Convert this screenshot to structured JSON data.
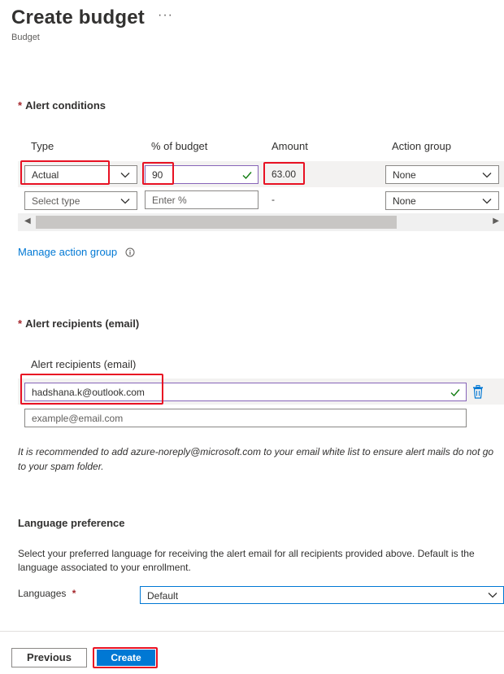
{
  "header": {
    "title": "Create budget",
    "more": "···",
    "subtitle": "Budget"
  },
  "alert_conditions": {
    "title": "Alert conditions",
    "required_mark": "*",
    "columns": [
      "Type",
      "% of budget",
      "Amount",
      "Action group"
    ],
    "rows": [
      {
        "type": "Actual",
        "percent": "90",
        "amount": "63.00",
        "action_group": "None"
      },
      {
        "type_placeholder": "Select type",
        "percent_placeholder": "Enter %",
        "amount": "-",
        "action_group": "None"
      }
    ],
    "manage_link": "Manage action group"
  },
  "alert_recipients": {
    "title": "Alert recipients (email)",
    "required_mark": "*",
    "column": "Alert recipients (email)",
    "email_value": "hadshana.k@outlook.com",
    "email_placeholder": "example@email.com",
    "note": "It is recommended to add azure-noreply@microsoft.com to your email white list to ensure alert mails do not go to your spam folder."
  },
  "language": {
    "title": "Language preference",
    "description": "Select your preferred language for receiving the alert email for all recipients provided above. Default is the language associated to your enrollment.",
    "label": "Languages",
    "required_mark": "*",
    "selected": "Default"
  },
  "footer": {
    "previous_label": "Previous",
    "create_label": "Create"
  },
  "colors": {
    "accent": "#0078d4",
    "highlight": "#e81123",
    "valid": "#107c10"
  }
}
